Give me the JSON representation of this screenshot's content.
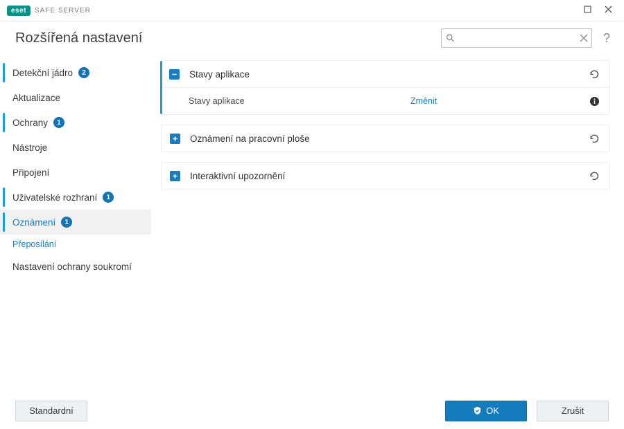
{
  "brand": {
    "pill": "eset",
    "text": "SAFE SERVER"
  },
  "page_title": "Rozšířená nastavení",
  "search": {
    "placeholder": ""
  },
  "help_glyph": "?",
  "sidebar": {
    "items": [
      {
        "label": "Detekční jádro",
        "badge": "2",
        "accent": true
      },
      {
        "label": "Aktualizace"
      },
      {
        "label": "Ochrany",
        "badge": "1",
        "accent": true
      },
      {
        "label": "Nástroje"
      },
      {
        "label": "Připojení"
      },
      {
        "label": "Uživatelské rozhraní",
        "badge": "1",
        "accent": true
      },
      {
        "label": "Oznámení",
        "badge": "1",
        "accent": true,
        "selected": true,
        "sub": "Přeposílání"
      },
      {
        "label": "Nastavení ochrany soukromí"
      }
    ]
  },
  "panels": {
    "p0": {
      "title": "Stavy aplikace",
      "row_label": "Stavy aplikace",
      "row_action": "Změnit"
    },
    "p1": {
      "title": "Oznámení na pracovní ploše"
    },
    "p2": {
      "title": "Interaktivní upozornění"
    }
  },
  "footer": {
    "default": "Standardní",
    "ok": "OK",
    "cancel": "Zrušit"
  }
}
